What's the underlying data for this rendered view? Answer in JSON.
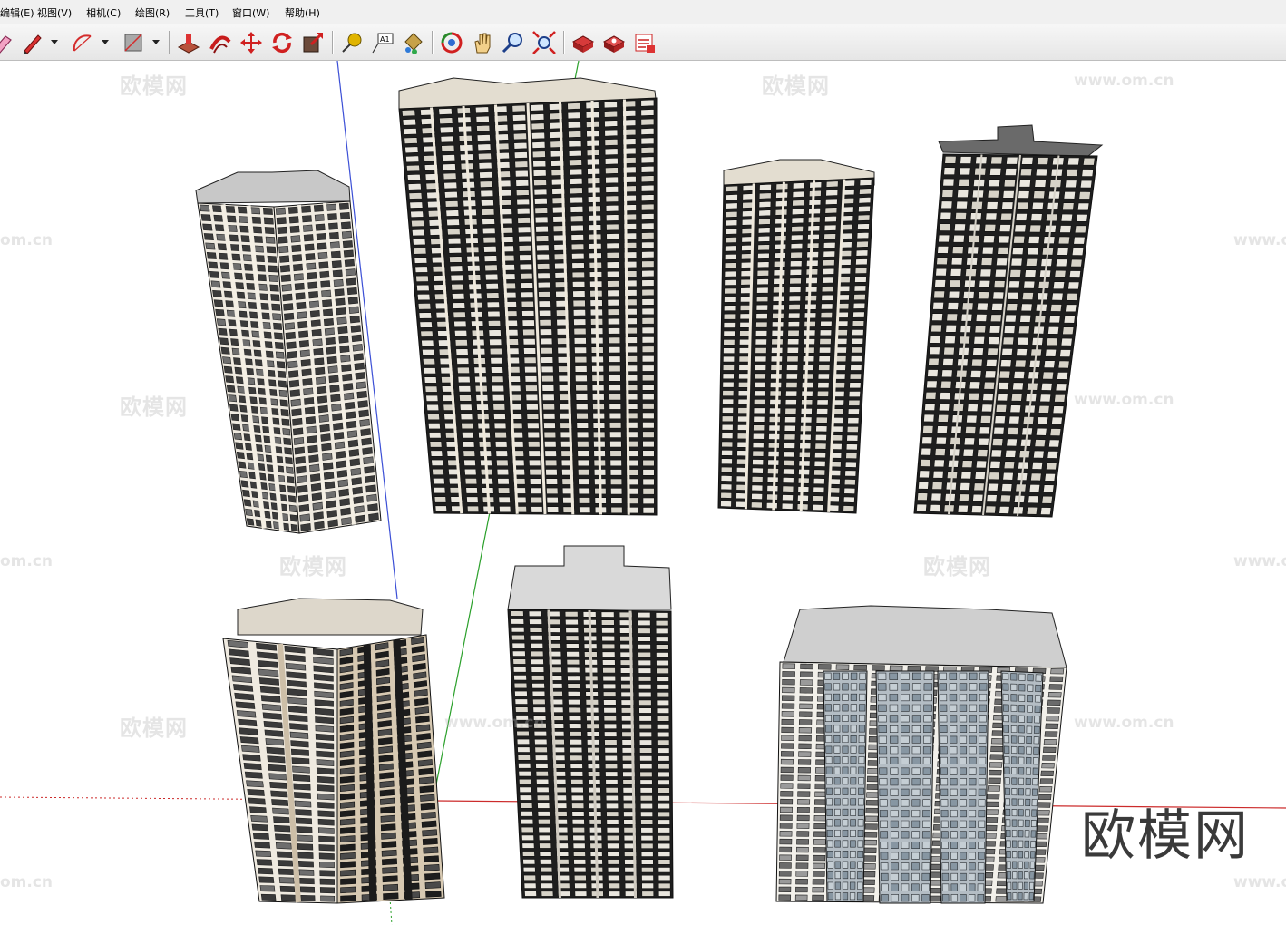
{
  "menubar": {
    "items": [
      "编辑(E)",
      "视图(V)",
      "相机(C)",
      "绘图(R)",
      "工具(T)",
      "窗口(W)",
      "帮助(H)"
    ]
  },
  "toolbar": {
    "buttons": [
      "eraser-icon",
      "pencil-icon",
      "arc-icon",
      "rectangle-icon",
      "push-pull-icon",
      "follow-me-icon",
      "move-icon",
      "rotate-icon",
      "scale-icon",
      "tape-measure-icon",
      "text-label-icon",
      "paint-bucket-icon",
      "orbit-icon",
      "pan-icon",
      "zoom-icon",
      "zoom-extents-icon",
      "warehouse-get-models-icon",
      "warehouse-share-model-icon",
      "extension-warehouse-icon"
    ]
  },
  "colors": {
    "axis_blue": "#3b4fd6",
    "axis_green": "#2aa02a",
    "axis_red": "#cc2b2b",
    "building_dark": "#2b2b2b",
    "building_light": "#e7e2d8",
    "roof_gray": "#c8c8c8"
  },
  "watermark": {
    "text": "欧模网",
    "url": "www.om.cn",
    "url_short": "om.cn"
  },
  "brand_logo": "欧模网"
}
